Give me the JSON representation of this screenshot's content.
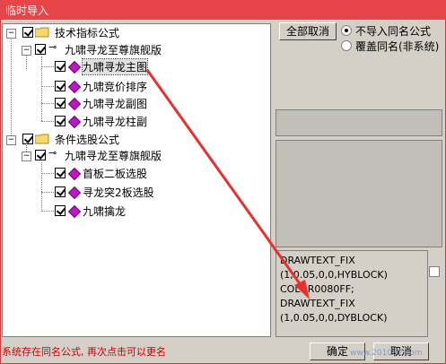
{
  "window": {
    "title": "临时导入"
  },
  "tree": {
    "groups": [
      {
        "label": "技术指标公式",
        "checked": true,
        "package": "九啸寻龙至尊旗舰版",
        "items": [
          "九啸寻龙主图",
          "九啸竞价排序",
          "九啸寻龙副图",
          "九啸寻龙柱副"
        ]
      },
      {
        "label": "条件选股公式",
        "checked": true,
        "package": "九啸寻龙至尊旗舰版",
        "items": [
          "首板二板选股",
          "寻龙突2板选股",
          "九啸擒龙"
        ]
      }
    ],
    "selected_item": "九啸寻龙主图"
  },
  "right": {
    "cancel_all": "全部取消",
    "radio_options": [
      {
        "label": "不导入同名公式",
        "selected": true
      },
      {
        "label": "覆盖同名(非系统)",
        "selected": false
      }
    ],
    "code_lines": [
      "DRAWTEXT_FIX",
      "(1,0.05,0,0,HYBLOCK)",
      "COLOR0080FF;",
      "DRAWTEXT_FIX",
      "(1,0.05,0,0,DYBLOCK)"
    ]
  },
  "footer": {
    "status": "系统存在同名公式, 再次点击可以更名",
    "ok": "确定",
    "cancel": "取消",
    "watermark": "www.201082.com"
  },
  "colors": {
    "titlebar": "#e8454a",
    "status_text": "#d00000",
    "arrow": "#e8302e"
  }
}
